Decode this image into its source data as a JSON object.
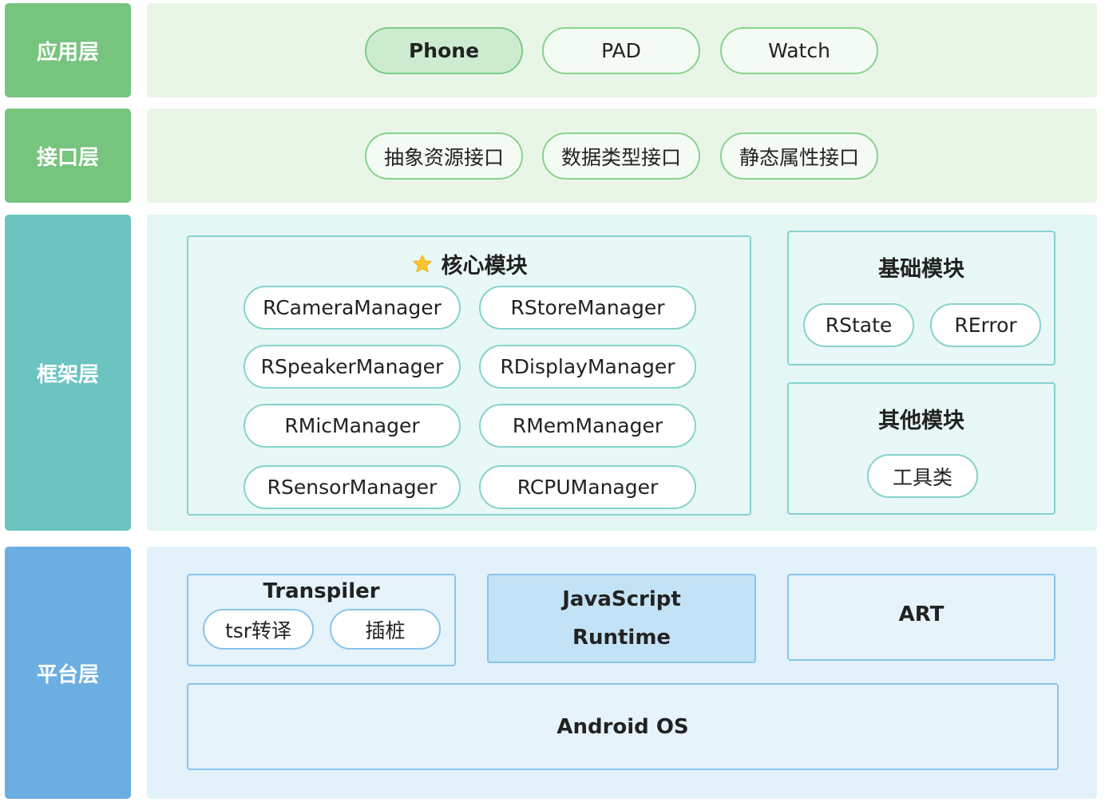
{
  "colors": {
    "app_label": "#77c47f",
    "interface_label": "#77c47f",
    "framework_label": "#6cc4c1",
    "platform_label": "#6aaee2",
    "green_panel": "#e9f6e7",
    "teal_panel": "#e4f6f3",
    "blue_panel": "#e3f1fb",
    "star": "#f6c531"
  },
  "layers": {
    "app": {
      "label": "应用层",
      "items": [
        "Phone",
        "PAD",
        "Watch"
      ]
    },
    "interface": {
      "label": "接口层",
      "items": [
        "抽象资源接口",
        "数据类型接口",
        "静态属性接口"
      ]
    },
    "framework": {
      "label": "框架层",
      "core": {
        "icon": "star-icon",
        "title": "核心模块",
        "items": [
          "RCameraManager",
          "RStoreManager",
          "RSpeakerManager",
          "RDisplayManager",
          "RMicManager",
          "RMemManager",
          "RSensorManager",
          "RCPUManager"
        ]
      },
      "basic": {
        "title": "基础模块",
        "items": [
          "RState",
          "RError"
        ]
      },
      "other": {
        "title": "其他模块",
        "items": [
          "工具类"
        ]
      }
    },
    "platform": {
      "label": "平台层",
      "transpiler": {
        "title": "Transpiler",
        "items": [
          "tsr转译",
          "插桩"
        ]
      },
      "js_runtime": {
        "line1": "JavaScript",
        "line2": "Runtime"
      },
      "art": "ART",
      "android": "Android OS"
    }
  }
}
